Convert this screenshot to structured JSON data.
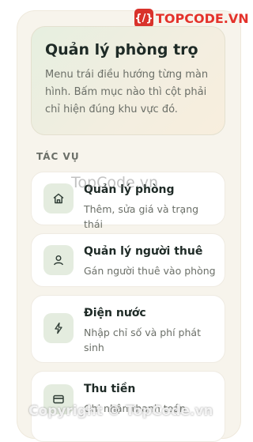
{
  "logo": {
    "mark": "{/}",
    "text": "TOPCODE.VN"
  },
  "hero": {
    "title": "Quản lý phòng trọ",
    "description": "Menu trái điều hướng từng màn hình. Bấm mục nào thì cột phải chỉ hiện đúng khu vực đó."
  },
  "section_label": "TÁC VỤ",
  "menu": [
    {
      "title": "Quản lý phòng",
      "subtitle": "Thêm, sửa giá và trạng thái",
      "icon": "home-icon"
    },
    {
      "title": "Quản lý người thuê",
      "subtitle": "Gán người thuê vào phòng",
      "icon": "user-icon"
    },
    {
      "title": "Điện nước",
      "subtitle": "Nhập chỉ số và phí phát sinh",
      "icon": "lightning-icon"
    },
    {
      "title": "Thu tiền",
      "subtitle": "Ghi nhận thanh toán",
      "icon": "payment-card-icon"
    }
  ],
  "watermarks": {
    "middle": "TopCode.vn",
    "bottom": "Copyright © TopCode.vn"
  },
  "colors": {
    "accent": "#e4322b",
    "panel": "#f7f4ec",
    "icon_bg": "#e4ecdf",
    "text": "#1e2a26"
  }
}
